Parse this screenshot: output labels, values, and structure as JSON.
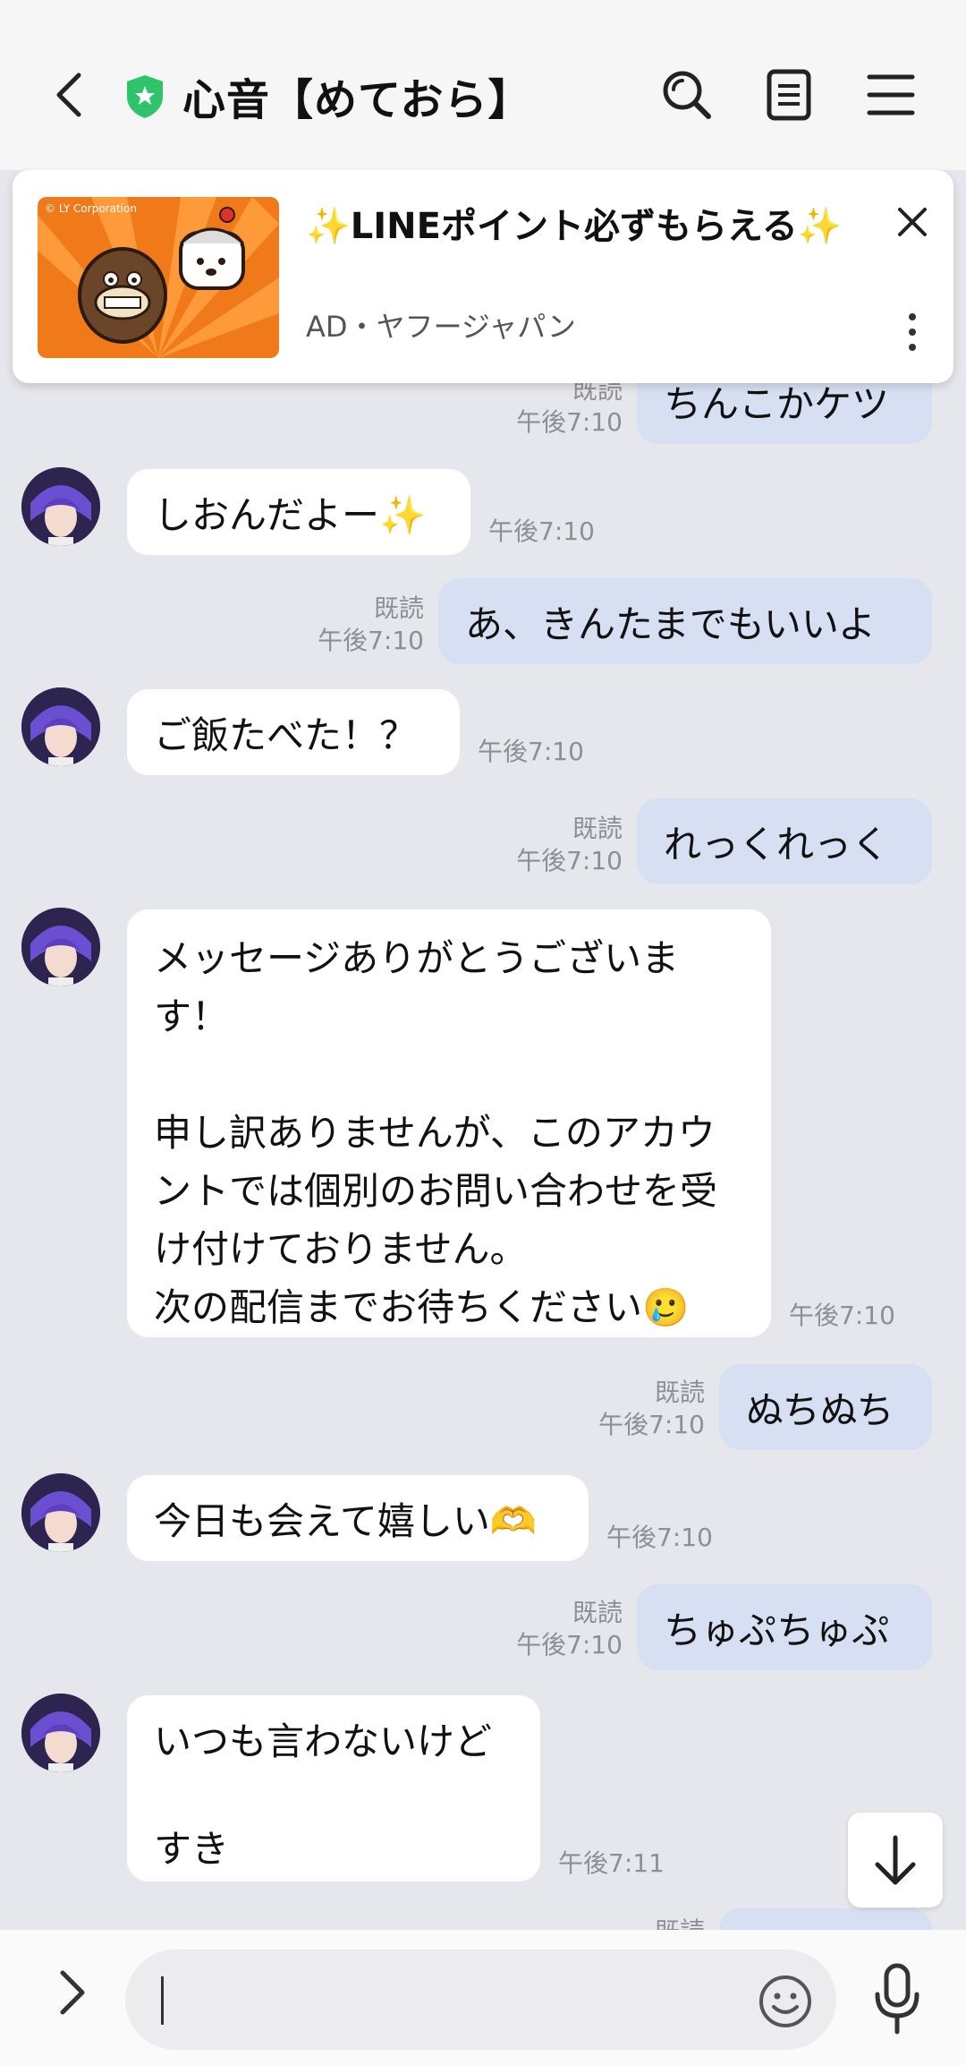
{
  "header": {
    "title": "心音【めておら】",
    "verified_badge": "shield-icon",
    "icons": [
      "back-icon",
      "search-icon",
      "notes-icon",
      "menu-icon"
    ]
  },
  "ad": {
    "title": "✨LINEポイント必ずもらえる✨",
    "source": "AD・ヤフージャパン",
    "image_credit": "© LY Corporation",
    "thumb_bg": "#f07a1a"
  },
  "messages": [
    {
      "dir": "out",
      "text": "ちんこかケツ",
      "read": "既読",
      "time": "午後7:10"
    },
    {
      "dir": "in",
      "text": "しおんだよー✨",
      "time": "午後7:10"
    },
    {
      "dir": "out",
      "text": "あ、きんたまでもいいよ",
      "read": "既読",
      "time": "午後7:10"
    },
    {
      "dir": "in",
      "text": "ご飯たべた！？",
      "time": "午後7:10"
    },
    {
      "dir": "out",
      "text": "れっくれっく",
      "read": "既読",
      "time": "午後7:10"
    },
    {
      "dir": "in",
      "text": "メッセージありがとうございます！\n\n申し訳ありませんが、このアカウントでは個別のお問い合わせを受け付けておりません。\n次の配信までお待ちください🥲",
      "time": "午後7:10"
    },
    {
      "dir": "out",
      "text": "ぬちぬち",
      "read": "既読",
      "time": "午後7:10"
    },
    {
      "dir": "in",
      "text": "今日も会えて嬉しい🫶",
      "time": "午後7:10"
    },
    {
      "dir": "out",
      "text": "ちゅぷちゅぷ",
      "read": "既読",
      "time": "午後7:10"
    },
    {
      "dir": "in",
      "text": "いつも言わないけど\n\nすき",
      "time": "午後7:11"
    },
    {
      "dir": "out",
      "text": "",
      "read": "既読",
      "time": ""
    }
  ],
  "input": {
    "placeholder": "",
    "value": ""
  },
  "colors": {
    "chat_bg": "#e6e7ec",
    "incoming_bubble": "#ffffff",
    "outgoing_bubble": "#d6e0f2",
    "verified_green": "#2fc46b"
  }
}
